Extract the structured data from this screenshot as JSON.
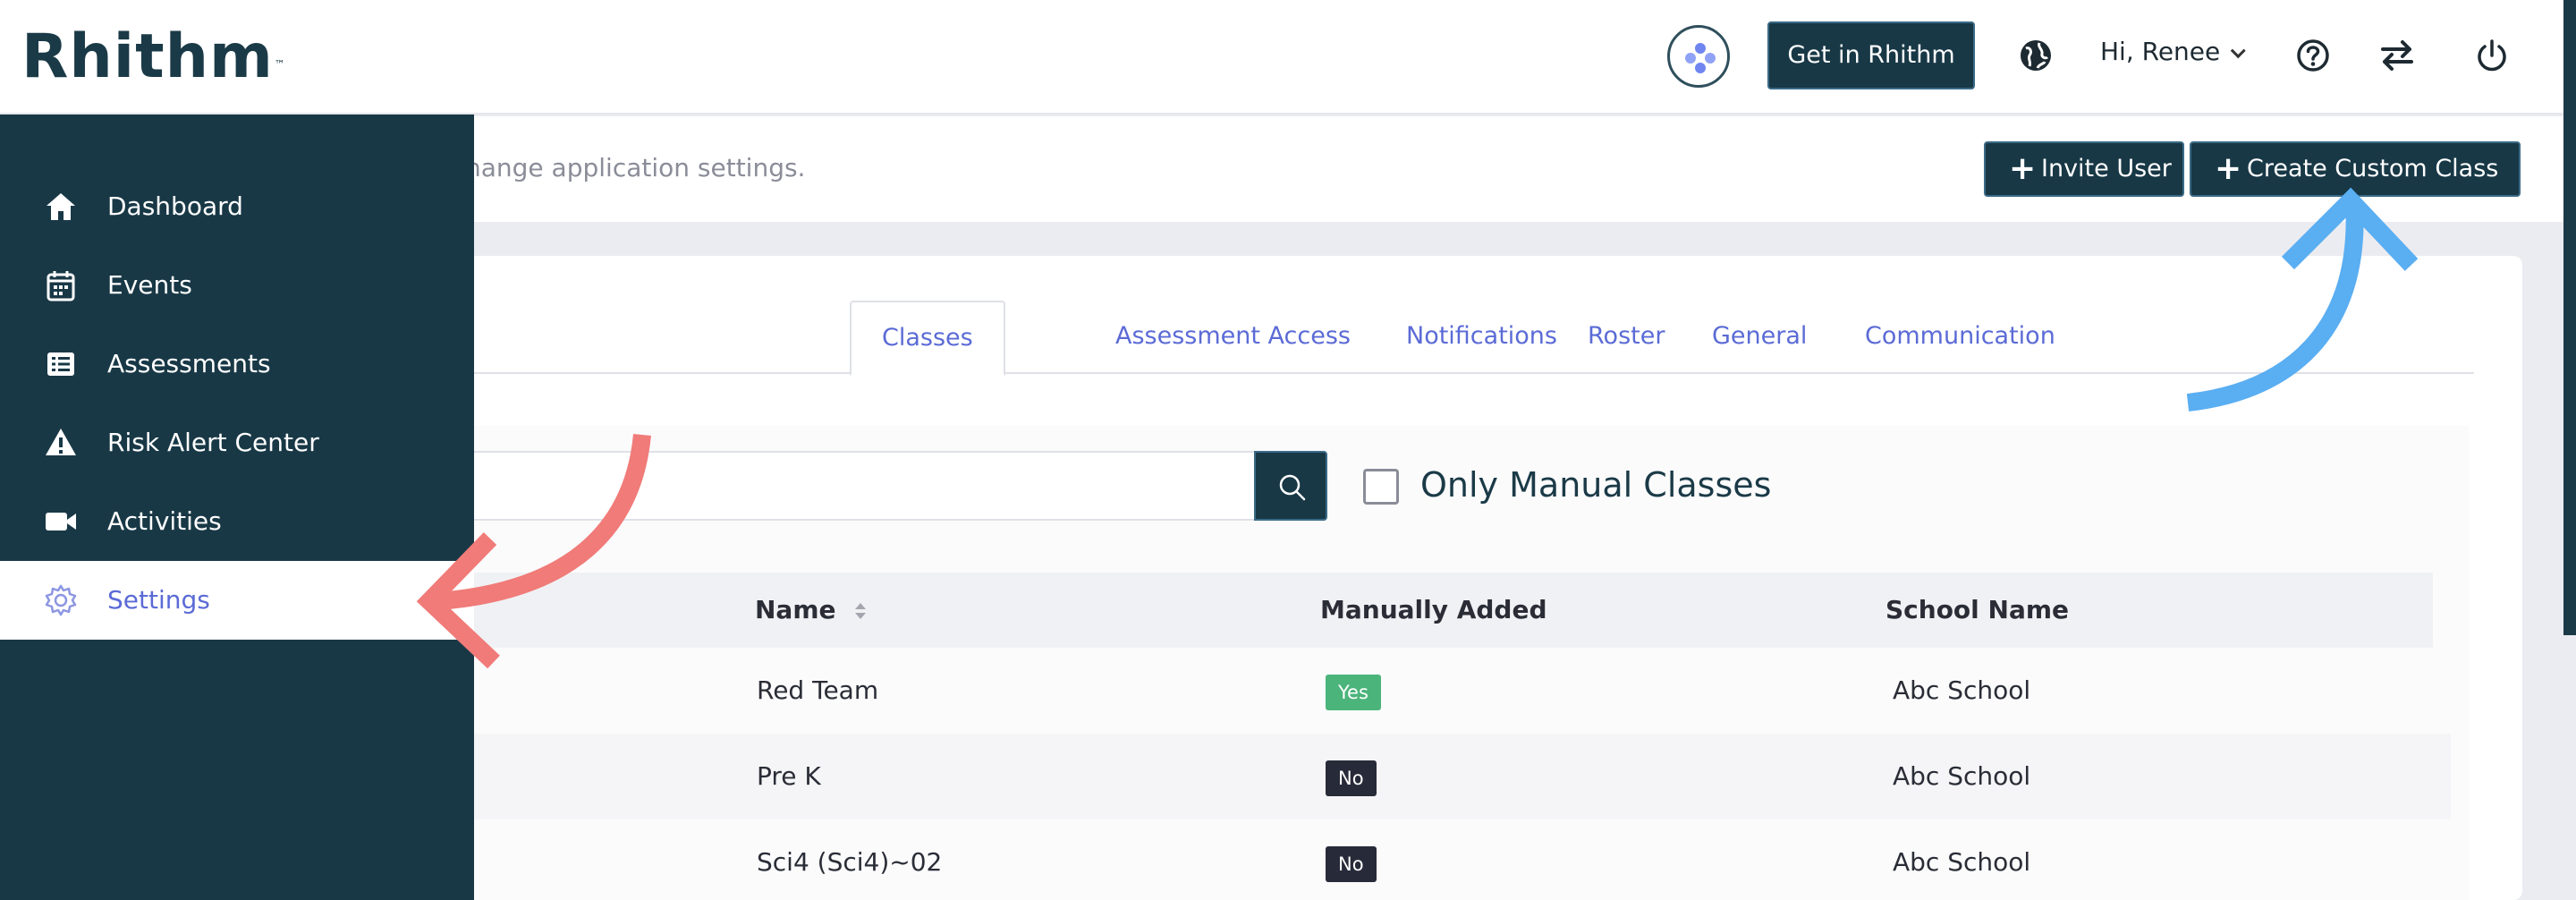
{
  "header": {
    "logo": "Rhithm",
    "logo_tm": "™",
    "get_button": "Get in Rhithm",
    "greeting": "Hi, Renee"
  },
  "page": {
    "subtitle": "hange application settings.",
    "invite_button": "Invite User",
    "create_button": "Create Custom Class",
    "plus_symbol": "+"
  },
  "sidebar": {
    "items": [
      {
        "label": "Dashboard",
        "icon": "home-icon"
      },
      {
        "label": "Events",
        "icon": "calendar-icon"
      },
      {
        "label": "Assessments",
        "icon": "list-icon"
      },
      {
        "label": "Risk Alert Center",
        "icon": "warning-icon"
      },
      {
        "label": "Activities",
        "icon": "video-icon"
      },
      {
        "label": "Settings",
        "icon": "gear-icon",
        "active": true
      }
    ]
  },
  "tabs": [
    {
      "label": "Classes",
      "active": true
    },
    {
      "label": "Assessment Access"
    },
    {
      "label": "Notifications"
    },
    {
      "label": "Roster"
    },
    {
      "label": "General"
    },
    {
      "label": "Communication"
    }
  ],
  "filters": {
    "search_placeholder": "",
    "manual_checkbox_label": "Only Manual Classes"
  },
  "table": {
    "headers": {
      "name": "Name",
      "manual": "Manually Added",
      "school": "School Name"
    },
    "rows": [
      {
        "name": "Red Team",
        "manual": "Yes",
        "school": "Abc School"
      },
      {
        "name": "Pre K",
        "manual": "No",
        "school": "Abc School"
      },
      {
        "name": "Sci4 (Sci4)~02",
        "manual": "No",
        "school": "Abc School"
      }
    ]
  },
  "colors": {
    "sidebar": "#183846",
    "accent": "#5b6bd6",
    "yes_badge": "#4bb47b",
    "no_badge": "#272a38",
    "arrow_red": "#f07b78",
    "arrow_blue": "#5aaef2"
  }
}
